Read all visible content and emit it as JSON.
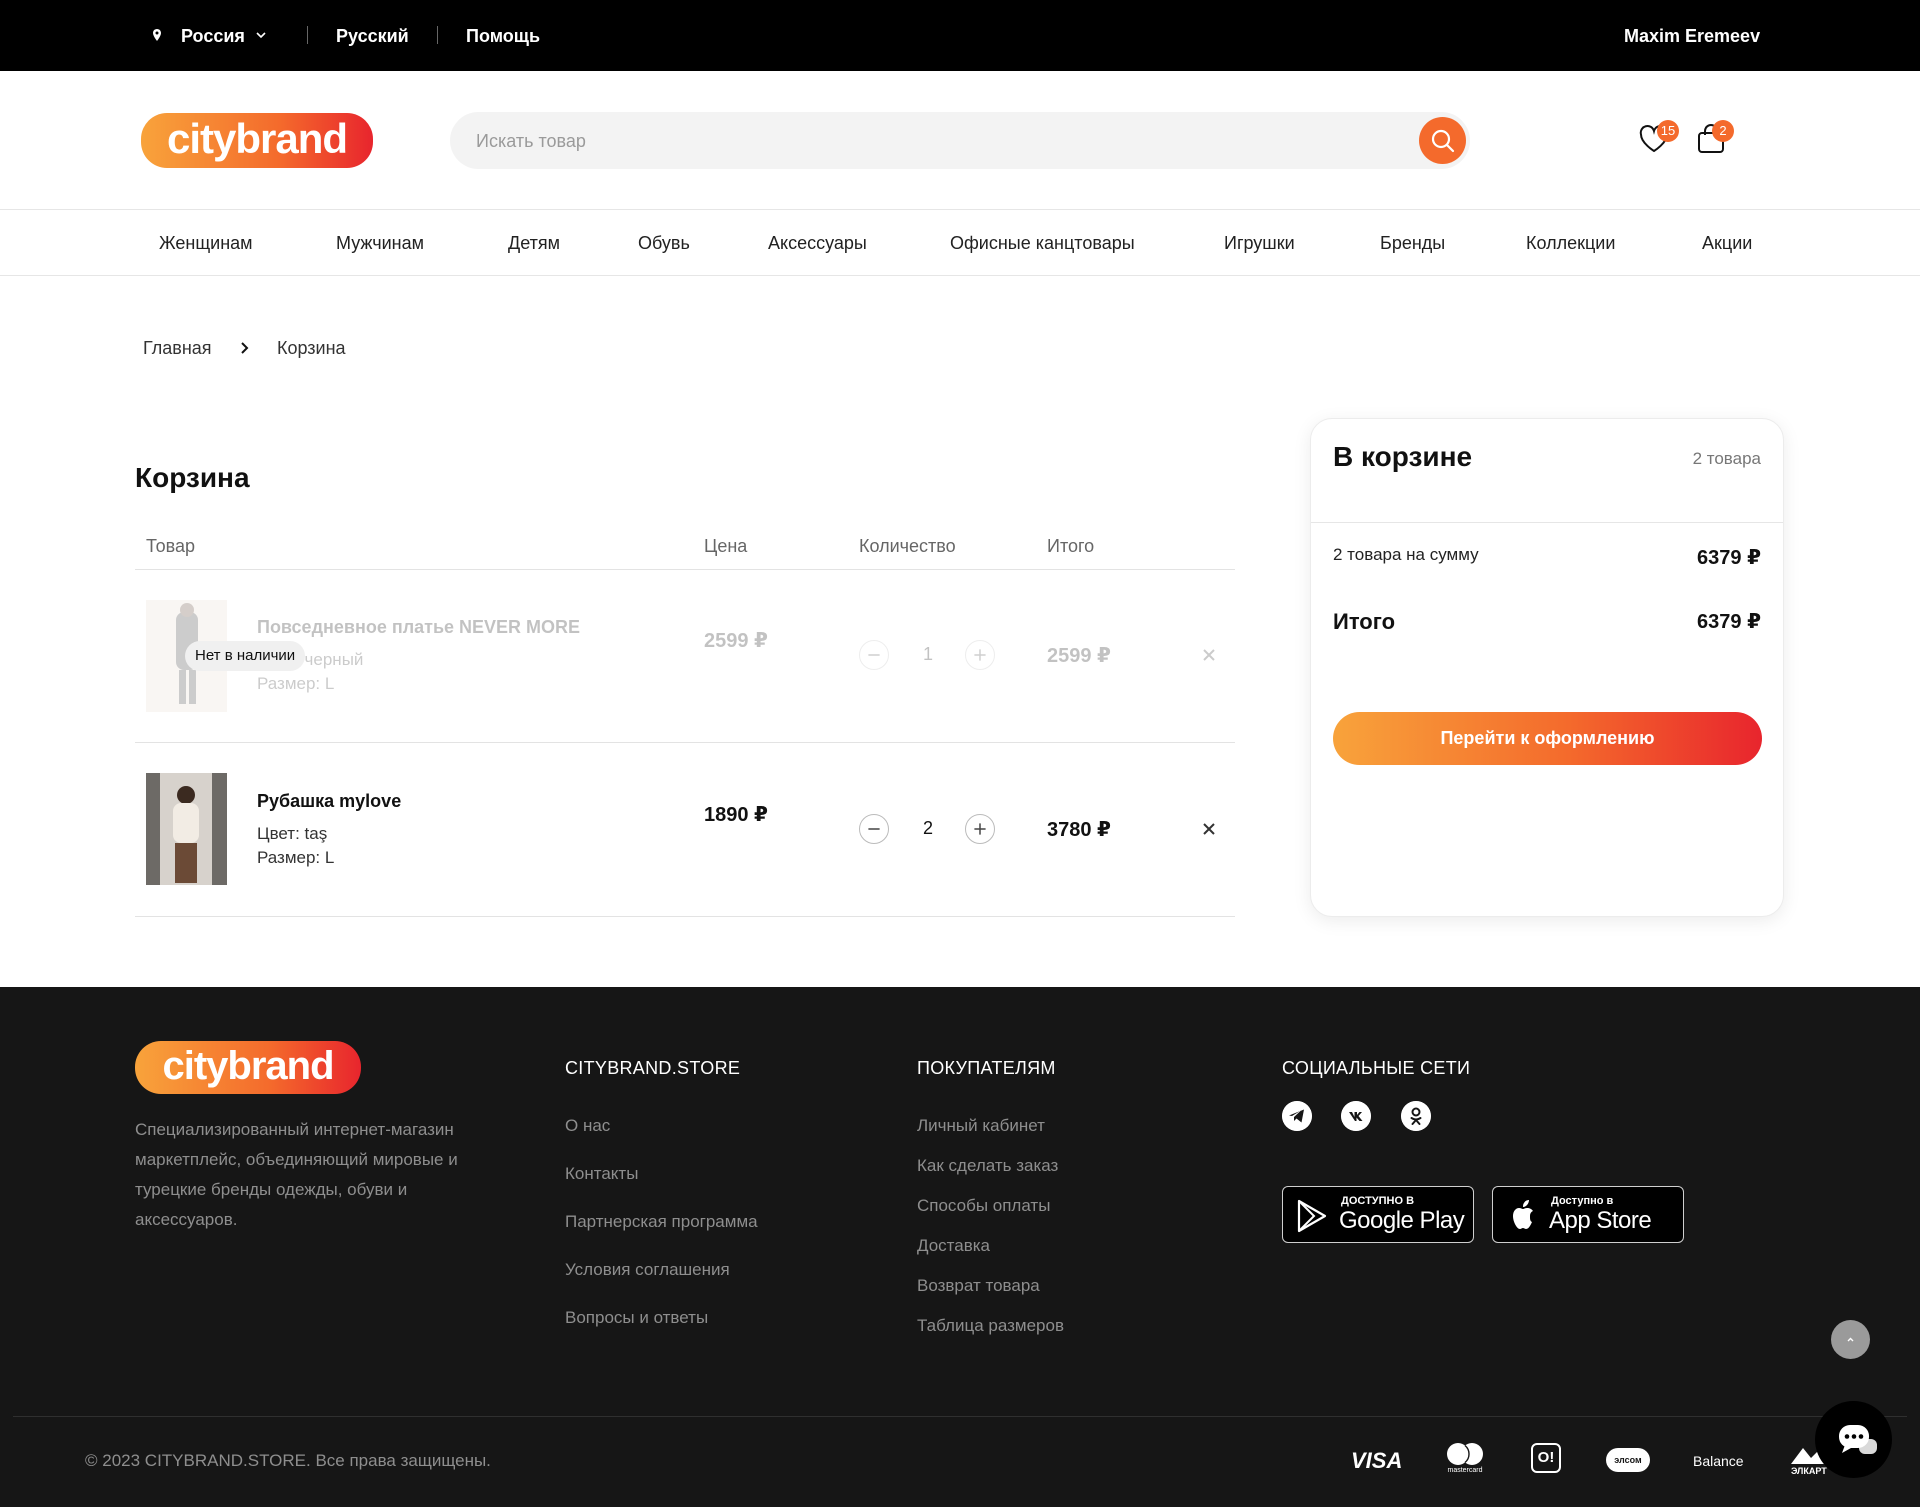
{
  "topbar": {
    "region": "Россия",
    "language": "Русский",
    "help": "Помощь",
    "user": "Maxim Eremeev"
  },
  "header": {
    "logo_text": "citybrand",
    "search_placeholder": "Искать товар",
    "favorites_count": "15",
    "cart_count": "2"
  },
  "nav": [
    "Женщинам",
    "Мужчинам",
    "Детям",
    "Обувь",
    "Аксессуары",
    "Офисные канцтовары",
    "Игрушки",
    "Бренды",
    "Коллекции",
    "Акции"
  ],
  "breadcrumb": {
    "home": "Главная",
    "current": "Корзина"
  },
  "cart": {
    "title": "Корзина",
    "columns": {
      "product": "Товар",
      "price": "Цена",
      "quantity": "Количество",
      "total": "Итого"
    },
    "items": [
      {
        "name": "Повседневное платье NEVER MORE",
        "color": "Цвет: черный",
        "size": "Размер: L",
        "price": "2599 ₽",
        "qty": "1",
        "total": "2599 ₽",
        "stock_label": "Нет в наличии",
        "in_stock": false
      },
      {
        "name": "Рубашка mylove",
        "color": "Цвет: taş",
        "size": "Размер: L",
        "price": "1890 ₽",
        "qty": "2",
        "total": "3780 ₽",
        "in_stock": true
      }
    ]
  },
  "summary": {
    "title": "В корзине",
    "count": "2 товара",
    "sum_label": "2 товара на сумму",
    "sum_value": "6379 ₽",
    "total_label": "Итого",
    "total_value": "6379 ₽",
    "checkout_label": "Перейти к оформлению"
  },
  "footer": {
    "logo_text": "citybrand",
    "description": "Специализированный интернет-магазин маркетплейс, объединяющий мировые и турецкие бренды одежды, обуви и аксессуаров.",
    "col1": {
      "title": "CITYBRAND.STORE",
      "links": [
        "О нас",
        "Контакты",
        "Партнерская программа",
        "Условия соглашения",
        "Вопросы и ответы"
      ]
    },
    "col2": {
      "title": "ПОКУПАТЕЛЯМ",
      "links": [
        "Личный кабинет",
        "Как сделать заказ",
        "Способы оплаты",
        "Доставка",
        "Возврат товара",
        "Таблица размеров"
      ]
    },
    "col3": {
      "title": "СОЦИАЛЬНЫЕ СЕТИ",
      "socials": [
        "telegram-icon",
        "vk-icon",
        "odnoklassniki-icon"
      ]
    },
    "google_play": {
      "small": "ДОСТУПНО В",
      "big": "Google Play"
    },
    "app_store": {
      "small": "Доступно в",
      "big": "App Store"
    },
    "copyright": "© 2023 CITYBRAND.STORE. Все права защищены.",
    "payments": {
      "visa": "VISA",
      "mastercard": "mastercard",
      "o": "O!",
      "elsom": "элсом",
      "balance": "Balance",
      "elcart": "ЭЛКАРТ"
    }
  },
  "colors": {
    "accent": "#f46a2c",
    "gradient_start": "#f8a33b",
    "gradient_end": "#e8252d",
    "topbar": "#000000",
    "footer": "#161616"
  }
}
